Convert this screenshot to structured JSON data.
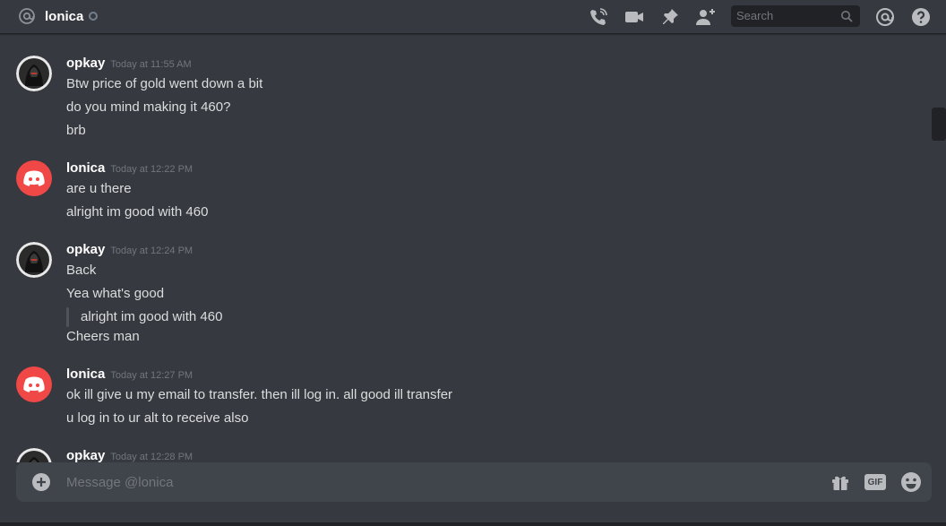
{
  "header": {
    "channel_name": "lonica",
    "icons": [
      "at-icon",
      "status-offline-icon",
      "phone-call-icon",
      "video-call-icon",
      "pin-icon",
      "add-friend-icon",
      "mention-icon",
      "help-icon"
    ],
    "search_placeholder": "Search"
  },
  "messages": [
    {
      "author": "opkay",
      "timestamp": "Today at 11:55 AM",
      "avatar": "hooded-figure-avatar",
      "lines": [
        "Btw price of gold went down a bit",
        "do you mind making it 460?",
        "brb"
      ]
    },
    {
      "author": "lonica",
      "timestamp": "Today at 12:22 PM",
      "avatar": "discord-default-avatar",
      "lines": [
        "are u there",
        "alright im good with 460"
      ]
    },
    {
      "author": "opkay",
      "timestamp": "Today at 12:24 PM",
      "avatar": "hooded-figure-avatar",
      "lines": [
        "Back",
        "Yea what's good"
      ],
      "quote": "alright im good with 460",
      "after_quote": [
        "Cheers man"
      ]
    },
    {
      "author": "lonica",
      "timestamp": "Today at 12:27 PM",
      "avatar": "discord-default-avatar",
      "lines": [
        "ok ill give u my email to transfer. then ill log in. all good ill transfer",
        "u log in to ur alt to receive also"
      ]
    },
    {
      "author": "opkay",
      "timestamp": "Today at 12:28 PM",
      "avatar": "hooded-figure-avatar",
      "lines": []
    }
  ],
  "composer": {
    "placeholder": "Message @lonica",
    "gif_label": "GIF"
  },
  "colors": {
    "background": "#36393f",
    "composer_bg": "#40444b",
    "search_bg": "#202225",
    "discord_red": "#f04747",
    "text": "#dcddde",
    "muted": "#72767d"
  }
}
